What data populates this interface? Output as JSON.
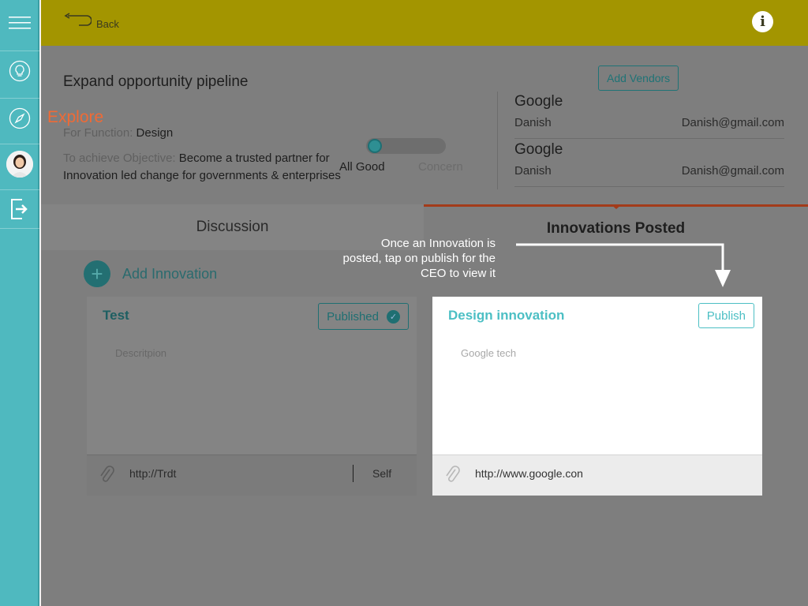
{
  "header": {
    "back_label": "Back",
    "info_icon": "i"
  },
  "sidebar": {
    "items": [
      {
        "name": "menu",
        "icon": "hamburger-icon"
      },
      {
        "name": "ideas",
        "icon": "lightbulb-icon"
      },
      {
        "name": "explore",
        "icon": "compass-icon"
      },
      {
        "name": "profile",
        "icon": "avatar"
      },
      {
        "name": "logout",
        "icon": "logout-icon"
      }
    ],
    "active_label": "Explore"
  },
  "opportunity": {
    "title": "Expand opportunity pipeline",
    "function_label": "For Function:",
    "function_value": "Design",
    "objective_label": "To achieve Objective:",
    "objective_value": "Become a trusted partner for Innovation led change for governments & enterprises"
  },
  "status_toggle": {
    "left_label": "All Good",
    "right_label": "Concern",
    "selected": "All Good"
  },
  "vendors": {
    "add_button": "Add Vendors",
    "list": [
      {
        "company": "Google",
        "contact": "Danish",
        "email": "Danish@gmail.com"
      },
      {
        "company": "Google",
        "contact": "Danish",
        "email": "Danish@gmail.com"
      }
    ]
  },
  "tabs": {
    "discussion": "Discussion",
    "innovations": "Innovations Posted",
    "active": "Innovations Posted"
  },
  "add_innovation": {
    "icon": "+",
    "label": "Add Innovation"
  },
  "cards": [
    {
      "title": "Test",
      "status_button": "Published",
      "status_icon": "✓",
      "description": "Descritpion",
      "link": "http://Trdt",
      "owner": "Self"
    },
    {
      "title": "Design innovation",
      "status_button": "Publish",
      "description": "Google tech",
      "link": "http://www.google.con"
    }
  ],
  "coach_mark": {
    "text": "Once an Innovation is posted, tap on publish for the CEO to view it"
  },
  "colors": {
    "sidebar": "#4fb9bf",
    "header": "#a39500",
    "accent": "#4cbfc4",
    "explore_label": "#f06a35",
    "tab_indicator": "#a33b1a"
  }
}
